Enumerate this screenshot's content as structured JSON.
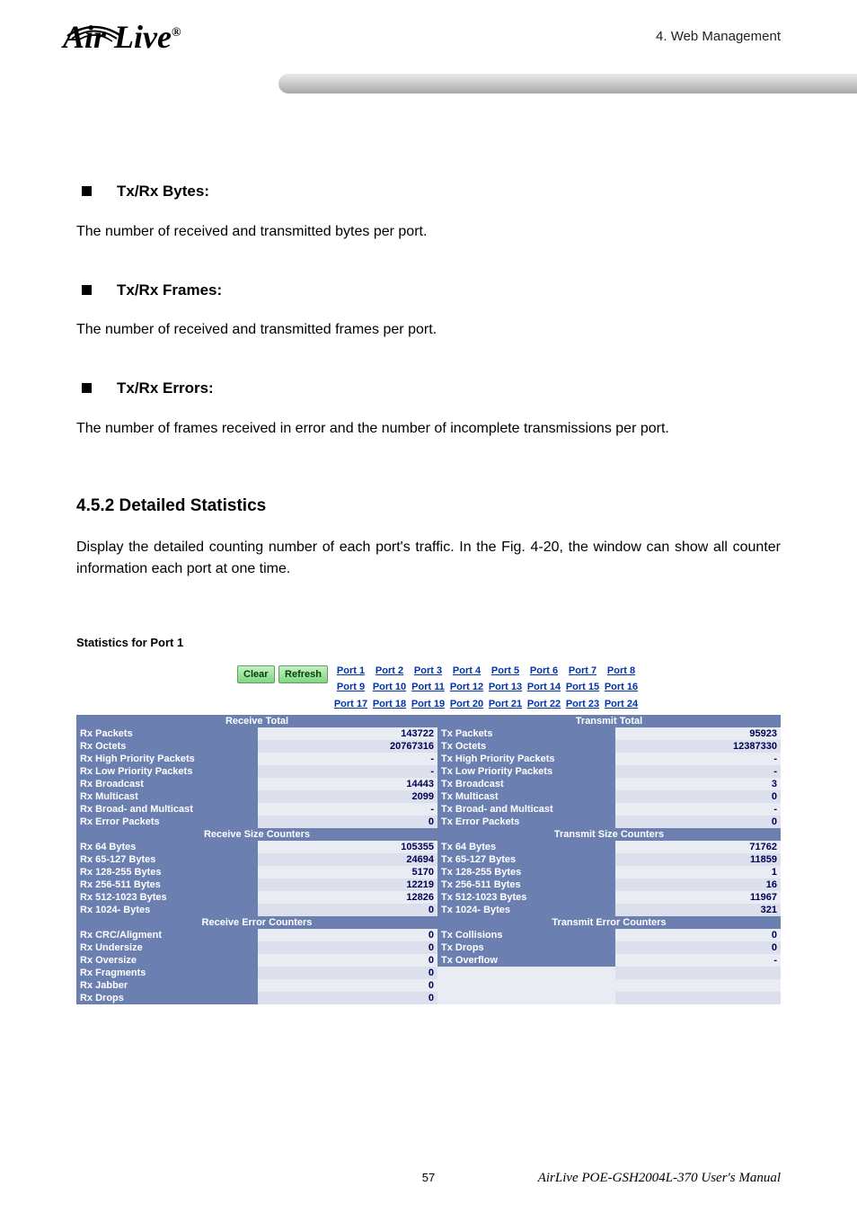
{
  "header": {
    "chapter": "4.  Web Management",
    "logo_text": "Air Live",
    "logo_r": "®"
  },
  "bullets": [
    {
      "title": "Tx/Rx Bytes:",
      "para": "The number of received and transmitted bytes per port."
    },
    {
      "title": "Tx/Rx Frames:",
      "para": "The number of received and transmitted frames per port."
    },
    {
      "title": "Tx/Rx Errors:",
      "para": "The number of frames received in error and the number of incomplete transmissions per port."
    }
  ],
  "section": {
    "heading": "4.5.2 Detailed Statistics",
    "para": "Display the detailed counting number of each port's traffic. In the Fig. 4-20, the window can show all counter information each port at one time."
  },
  "stats": {
    "title": "Statistics for Port 1",
    "buttons": {
      "clear": "Clear",
      "refresh": "Refresh"
    },
    "ports": [
      [
        "Port 1",
        "Port 2",
        "Port 3",
        "Port 4",
        "Port 5",
        "Port 6",
        "Port 7",
        "Port 8"
      ],
      [
        "Port 9",
        "Port 10",
        "Port 11",
        "Port 12",
        "Port 13",
        "Port 14",
        "Port 15",
        "Port 16"
      ],
      [
        "Port 17",
        "Port 18",
        "Port 19",
        "Port 20",
        "Port 21",
        "Port 22",
        "Port 23",
        "Port 24"
      ]
    ],
    "headers": {
      "recv_total": "Receive Total",
      "trans_total": "Transmit Total",
      "recv_size": "Receive Size Counters",
      "trans_size": "Transmit Size Counters",
      "recv_err": "Receive Error Counters",
      "trans_err": "Transmit Error Counters"
    },
    "total_rows": [
      {
        "rx_l": "Rx Packets",
        "rx_v": "143722",
        "tx_l": "Tx Packets",
        "tx_v": "95923"
      },
      {
        "rx_l": "Rx Octets",
        "rx_v": "20767316",
        "tx_l": "Tx Octets",
        "tx_v": "12387330"
      },
      {
        "rx_l": "Rx High Priority Packets",
        "rx_v": "-",
        "tx_l": "Tx High Priority Packets",
        "tx_v": "-"
      },
      {
        "rx_l": "Rx Low Priority Packets",
        "rx_v": "-",
        "tx_l": "Tx Low Priority Packets",
        "tx_v": "-"
      },
      {
        "rx_l": "Rx Broadcast",
        "rx_v": "14443",
        "tx_l": "Tx Broadcast",
        "tx_v": "3"
      },
      {
        "rx_l": "Rx Multicast",
        "rx_v": "2099",
        "tx_l": "Tx Multicast",
        "tx_v": "0"
      },
      {
        "rx_l": "Rx Broad- and Multicast",
        "rx_v": "-",
        "tx_l": "Tx Broad- and Multicast",
        "tx_v": "-"
      },
      {
        "rx_l": "Rx Error Packets",
        "rx_v": "0",
        "tx_l": "Tx Error Packets",
        "tx_v": "0"
      }
    ],
    "size_rows": [
      {
        "rx_l": "Rx 64 Bytes",
        "rx_v": "105355",
        "tx_l": "Tx 64 Bytes",
        "tx_v": "71762"
      },
      {
        "rx_l": "Rx 65-127 Bytes",
        "rx_v": "24694",
        "tx_l": "Tx 65-127 Bytes",
        "tx_v": "11859"
      },
      {
        "rx_l": "Rx 128-255 Bytes",
        "rx_v": "5170",
        "tx_l": "Tx 128-255 Bytes",
        "tx_v": "1"
      },
      {
        "rx_l": "Rx 256-511 Bytes",
        "rx_v": "12219",
        "tx_l": "Tx 256-511 Bytes",
        "tx_v": "16"
      },
      {
        "rx_l": "Rx 512-1023 Bytes",
        "rx_v": "12826",
        "tx_l": "Tx 512-1023 Bytes",
        "tx_v": "11967"
      },
      {
        "rx_l": "Rx 1024- Bytes",
        "rx_v": "0",
        "tx_l": "Tx 1024- Bytes",
        "tx_v": "321"
      }
    ],
    "err_rows": [
      {
        "rx_l": "Rx CRC/Aligment",
        "rx_v": "0",
        "tx_l": "Tx Collisions",
        "tx_v": "0"
      },
      {
        "rx_l": "Rx Undersize",
        "rx_v": "0",
        "tx_l": "Tx Drops",
        "tx_v": "0"
      },
      {
        "rx_l": "Rx Oversize",
        "rx_v": "0",
        "tx_l": "Tx Overflow",
        "tx_v": "-"
      },
      {
        "rx_l": "Rx Fragments",
        "rx_v": "0",
        "tx_l": "",
        "tx_v": ""
      },
      {
        "rx_l": "Rx Jabber",
        "rx_v": "0",
        "tx_l": "",
        "tx_v": ""
      },
      {
        "rx_l": "Rx Drops",
        "rx_v": "0",
        "tx_l": "",
        "tx_v": ""
      }
    ]
  },
  "footer": {
    "page": "57",
    "manual": "AirLive POE-GSH2004L-370 User's Manual"
  }
}
